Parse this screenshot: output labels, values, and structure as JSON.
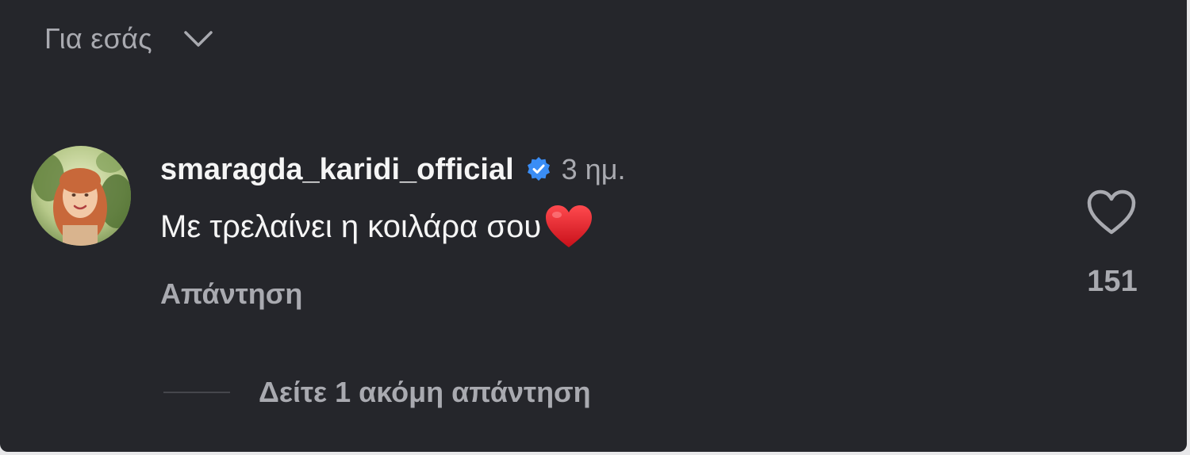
{
  "sort": {
    "label": "Για εσάς",
    "icon": "chevron-down-icon"
  },
  "comment": {
    "username": "smaragda_karidi_official",
    "verified_icon": "verified-badge-icon",
    "time": "3 ημ.",
    "text": "Με τρελαίνει η κοιλάρα σου",
    "emoji": "red-heart-emoji",
    "reply_label": "Απάντηση",
    "like_icon": "heart-outline-icon",
    "like_count": "151",
    "view_replies_label": "Δείτε 1 ακόμη απάντηση"
  },
  "colors": {
    "background": "#25262b",
    "primary_text": "#f5f5f5",
    "secondary_text": "#a9aab0",
    "verified_blue": "#3a8df5",
    "heart_red": "#e0202a"
  }
}
